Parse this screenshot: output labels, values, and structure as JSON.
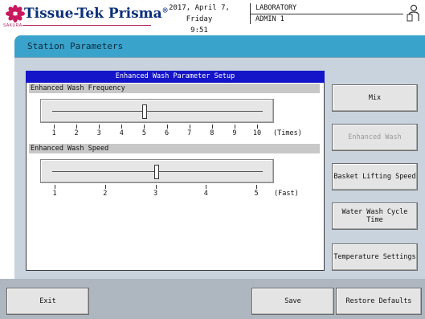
{
  "header": {
    "logo_text": "Tissue-Tek Prisma",
    "logo_reg": "®",
    "brand_sub": "SAKURA",
    "date": "2017, April 7, Friday",
    "time": "9:51",
    "location": "LABORATORY",
    "user": "ADMIN 1",
    "user_icon": "user-icon"
  },
  "window": {
    "title": "Station Parameters"
  },
  "panel": {
    "title": "Enhanced Wash Parameter Setup",
    "frequency": {
      "label": "Enhanced Wash Frequency",
      "ticks": [
        "1",
        "2",
        "3",
        "4",
        "5",
        "6",
        "7",
        "8",
        "9",
        "10"
      ],
      "value": 5,
      "min": 1,
      "max": 10,
      "unit": "(Times)"
    },
    "speed": {
      "label": "Enhanced Wash Speed",
      "ticks": [
        "1",
        "2",
        "3",
        "4",
        "5"
      ],
      "value": 3,
      "min": 1,
      "max": 5,
      "unit": "(Fast)"
    }
  },
  "side_buttons": [
    {
      "label": "Mix",
      "enabled": true
    },
    {
      "label": "Enhanced Wash",
      "enabled": false
    },
    {
      "label": "Basket Lifting Speed",
      "enabled": true
    },
    {
      "label": "Water Wash Cycle Time",
      "enabled": true
    },
    {
      "label": "Temperature Settings",
      "enabled": true
    }
  ],
  "bottom": {
    "exit": "Exit",
    "save": "Save",
    "restore": "Restore Defaults"
  },
  "colors": {
    "title_bar": "#3aa3cc",
    "panel_header": "#1414c8",
    "frame": "#c8d3dd",
    "bottom_bar": "#aeb7bf",
    "logo": "#0a2f7a",
    "brand": "#b0185a"
  }
}
